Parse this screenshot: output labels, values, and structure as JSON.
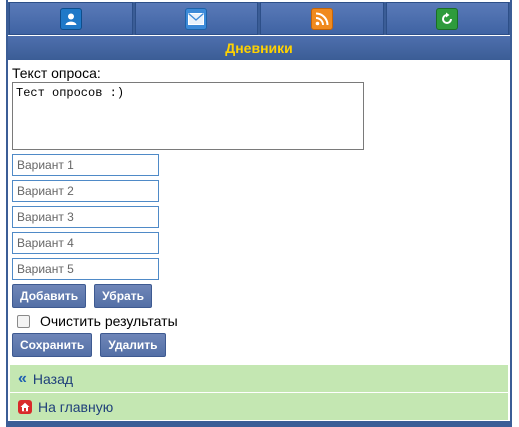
{
  "nav": {
    "icons": [
      "user-icon",
      "mail-icon",
      "rss-icon",
      "refresh-icon"
    ]
  },
  "header": {
    "title": "Дневники"
  },
  "form": {
    "poll_label": "Текст опроса:",
    "poll_text": "Тест опросов :)",
    "variants": [
      "Вариант 1",
      "Вариант 2",
      "Вариант 3",
      "Вариант 4",
      "Вариант 5"
    ],
    "add_label": "Добавить",
    "remove_label": "Убрать",
    "clear_results_label": "Очистить результаты",
    "clear_results_checked": false,
    "save_label": "Сохранить",
    "delete_label": "Удалить"
  },
  "links": {
    "back_label": "Назад",
    "home_label": "На главную"
  },
  "colors": {
    "header_bg": "#3b5d96",
    "title_text": "#ffd200",
    "link_bg": "#c4e7b2"
  }
}
